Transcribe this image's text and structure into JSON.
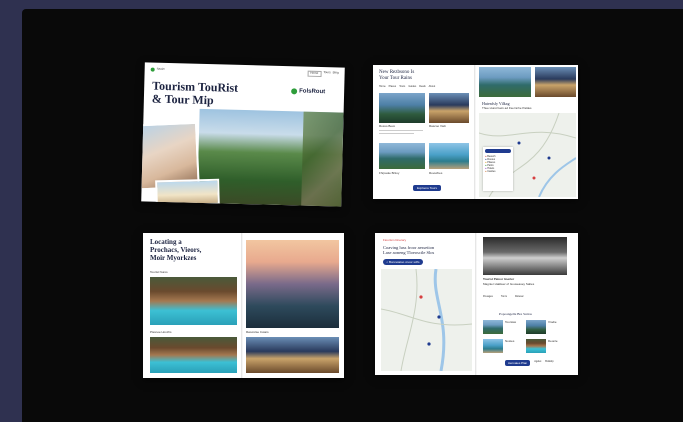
{
  "spread1": {
    "logo": "Seeirt",
    "nav": [
      "Home",
      "Tours",
      "Blog"
    ],
    "title_line1": "Tourism TouRist",
    "title_line2": "& Tour Mip",
    "brand": "FolsRout"
  },
  "spread2": {
    "heading_line1": "New Rezbsono Is",
    "heading_line2": "Your Tour Rains",
    "tabs": [
      "Home",
      "Places",
      "Tours",
      "Guides",
      "Deals",
      "About"
    ],
    "card_labels": [
      "Rosso Bevo",
      "Rascoo Vieb",
      "Fhrpaole Brtiuy",
      "Rovezbes"
    ],
    "right_title": "Hutenfsfy Vilkag",
    "right_subtitle": "Thue Huncrtvelv ad Fsernnhe Paldes",
    "button": "Exploore Tours",
    "legend": [
      "Beasch",
      "Routes",
      "Pilaces",
      "Parks",
      "Hotels",
      "Castles"
    ]
  },
  "spread3": {
    "title_line1": "Locating a",
    "title_line2": "Prochacs, Vieors,",
    "title_line3": "Moir Myorkzes",
    "label_top": "Tourist Nuros",
    "label_bottom_left": "Pissnoe Hovzhs",
    "label_bottom_right": "Rwezolse Cotars"
  },
  "spread4": {
    "kicker": "Fiourism Itinerary",
    "heading_line1": "Coaving luss froor aessetion",
    "heading_line2": "Lase aoneng Tloeosctle Slos",
    "search": "Bonnetatoo vnoor sclfs",
    "right_caption": "Tourist Paloor lioerter",
    "right_caption2": "Magnier Haikleer of Gouseasey Saltes",
    "chips": [
      "Pouages",
      "Tonrs",
      "Rolesar"
    ],
    "section_title": "Popoangelle Bre Suttos",
    "items": [
      "Toursiax",
      "Vrodie",
      "Nostes",
      "Deonle"
    ],
    "buttons": [
      "Aenvaies Plan",
      "Agolet",
      "Boldolp"
    ]
  },
  "colors": {
    "frame": "#2f3150",
    "stage": "#090909",
    "accent": "#1f3b8f",
    "brand_green": "#2e9d3a"
  }
}
